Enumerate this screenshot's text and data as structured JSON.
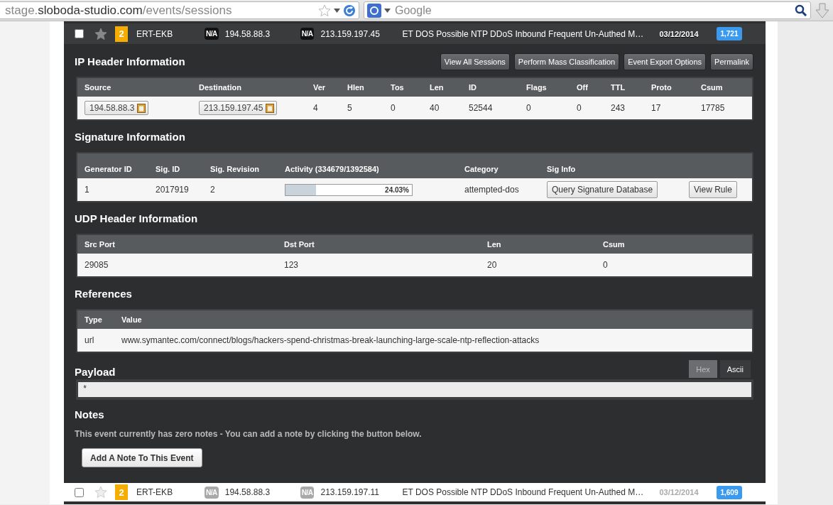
{
  "browser": {
    "url": {
      "prefix": "stage.",
      "domain": "sloboda-studio.com",
      "path": "/events/sessions"
    },
    "search": {
      "placeholder": "Google"
    }
  },
  "events": [
    {
      "checked": false,
      "starred": false,
      "expanded": true,
      "severity": "2",
      "sensor": "ERT-EKB",
      "src_country": "N/A",
      "src_ip": "194.58.88.3",
      "dst_country": "N/A",
      "dst_ip": "213.159.197.45",
      "signature": "ET DOS Possible NTP DDoS Inbound Frequent Un-Authed M…",
      "date": "03/12/2014",
      "count": "1,721"
    },
    {
      "checked": false,
      "starred": false,
      "expanded": false,
      "severity": "2",
      "sensor": "ERT-EKB",
      "src_country": "N/A",
      "src_ip": "194.58.88.3",
      "dst_country": "N/A",
      "dst_ip": "213.159.197.11",
      "signature": "ET DOS Possible NTP DDoS Inbound Frequent Un-Authed M…",
      "date": "03/12/2014",
      "count": "1,609"
    }
  ],
  "event_details": {
    "ip_header": {
      "title": "IP Header Information",
      "actions": [
        "View All Sessions",
        "Perform Mass Classification",
        "Event Export Options",
        "Permalink"
      ],
      "columns": [
        "Source",
        "Destination",
        "Ver",
        "Hlen",
        "Tos",
        "Len",
        "ID",
        "Flags",
        "Off",
        "TTL",
        "Proto",
        "Csum"
      ],
      "cells": [
        {
          "kind": "copyable",
          "text": "194.58.88.3"
        },
        {
          "kind": "copyable",
          "text": "213.159.197.45"
        },
        {
          "kind": "text",
          "text": "4"
        },
        {
          "kind": "text",
          "text": "5"
        },
        {
          "kind": "text",
          "text": "0"
        },
        {
          "kind": "text",
          "text": "40"
        },
        {
          "kind": "text",
          "text": "52544"
        },
        {
          "kind": "text",
          "text": "0"
        },
        {
          "kind": "text",
          "text": "0"
        },
        {
          "kind": "text",
          "text": "243"
        },
        {
          "kind": "text",
          "text": "17"
        },
        {
          "kind": "text",
          "text": "17785"
        }
      ]
    },
    "signature": {
      "title": "Signature Information",
      "columns": [
        "Generator ID",
        "Sig. ID",
        "Sig. Revision",
        "Activity (334679/1392584)",
        "Category",
        "Sig Info"
      ],
      "cells": [
        {
          "kind": "text",
          "text": "1"
        },
        {
          "kind": "text",
          "text": "2017919"
        },
        {
          "kind": "text",
          "text": "2"
        },
        {
          "kind": "meter",
          "level": 0.2403,
          "text": "24.03%"
        },
        {
          "kind": "text",
          "text": "attempted-dos"
        },
        {
          "kind": "button",
          "text": "Query Signature Database"
        },
        {
          "kind": "button",
          "text": "View Rule"
        }
      ]
    },
    "udp_header": {
      "title": "UDP Header Information",
      "columns": [
        "Src Port",
        "Dst Port",
        "Len",
        "Csum"
      ],
      "cells": [
        {
          "kind": "text",
          "text": "29085"
        },
        {
          "kind": "text",
          "text": "123"
        },
        {
          "kind": "text",
          "text": "20"
        },
        {
          "kind": "text",
          "text": "0"
        }
      ]
    },
    "references": {
      "title": "References",
      "columns": [
        "Type",
        "Value"
      ],
      "cells": [
        {
          "kind": "text",
          "text": "url"
        },
        {
          "kind": "text",
          "text": "www.symantec.com/connect/blogs/hackers-spend-christmas-break-launching-large-scale-ntp-reflection-attacks"
        }
      ]
    },
    "payload": {
      "title": "Payload",
      "formats": [
        {
          "label": "Hex",
          "selected": false
        },
        {
          "label": "Ascii",
          "selected": true
        }
      ],
      "content": "*"
    },
    "notes": {
      "title": "Notes",
      "message": "This event currently has zero notes - You can add a note by clicking the button below.",
      "button": "Add A Note To This Event"
    }
  }
}
